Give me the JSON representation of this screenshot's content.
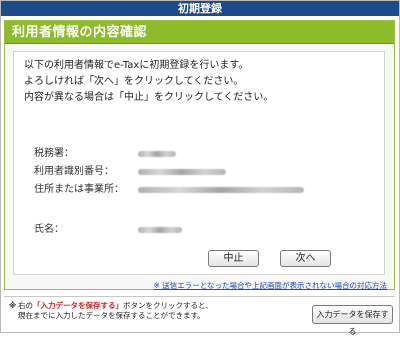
{
  "window": {
    "title": "初期登録"
  },
  "panel": {
    "title": "利用者情報の内容確認",
    "intro_lines": [
      "以下の利用者情報でe-Taxに初期登録を行います。",
      "よろしければ「次へ」をクリックしてください。",
      "内容が異なる場合は「中止」をクリックしてください。"
    ]
  },
  "fields": {
    "tax_office_label": "税務署：",
    "user_id_label": "利用者識別番号：",
    "address_label": "住所または事業所：",
    "name_label": "氏名："
  },
  "buttons": {
    "cancel": "中止",
    "next": "次へ",
    "save": "入力データを保存する"
  },
  "help": {
    "link": "※ 送信エラーとなった場合や上記画面が表示されない場合の対応方法"
  },
  "footer": {
    "mark": "※",
    "line1_before": "右の",
    "line1_highlight": "「入力データを保存する」",
    "line1_after": "ボタンをクリックすると、",
    "line2": "現在までに入力したデータを保存することができます。"
  }
}
